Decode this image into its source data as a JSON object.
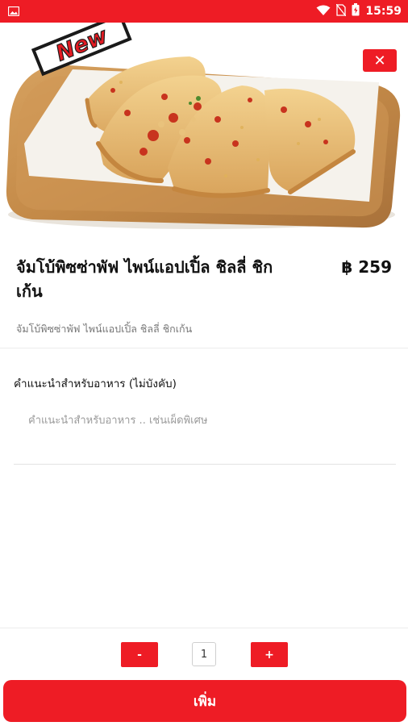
{
  "status_bar": {
    "time": "15:59",
    "background": "#ee1c25",
    "icons": [
      "gallery-icon",
      "wifi-icon",
      "no-sim-icon",
      "battery-icon"
    ]
  },
  "hero": {
    "badge_text": "New",
    "image": "calzone-pizza-on-wooden-board"
  },
  "close_button": {
    "label": "✕"
  },
  "product": {
    "name": "จัมโบ้พิซซ่าพัฟ ไพน์แอปเปิ้ล ชิลลี่ ชิกเก้น",
    "price": "฿ 259",
    "description": "จัมโบ้พิซซ่าพัฟ ไพน์แอปเปิ้ล ชิลลี่ ชิกเก้น"
  },
  "instructions": {
    "label": "คำแนะนำสำหรับอาหาร (ไม่บังคับ)",
    "placeholder": "คำแนะนำสำหรับอาหาร .. เช่นเผ็ดพิเศษ",
    "value": ""
  },
  "quantity": {
    "minus_label": "-",
    "value": "1",
    "plus_label": "+"
  },
  "add_button": {
    "label": "เพิ่ม"
  },
  "colors": {
    "accent": "#ee1c25"
  }
}
